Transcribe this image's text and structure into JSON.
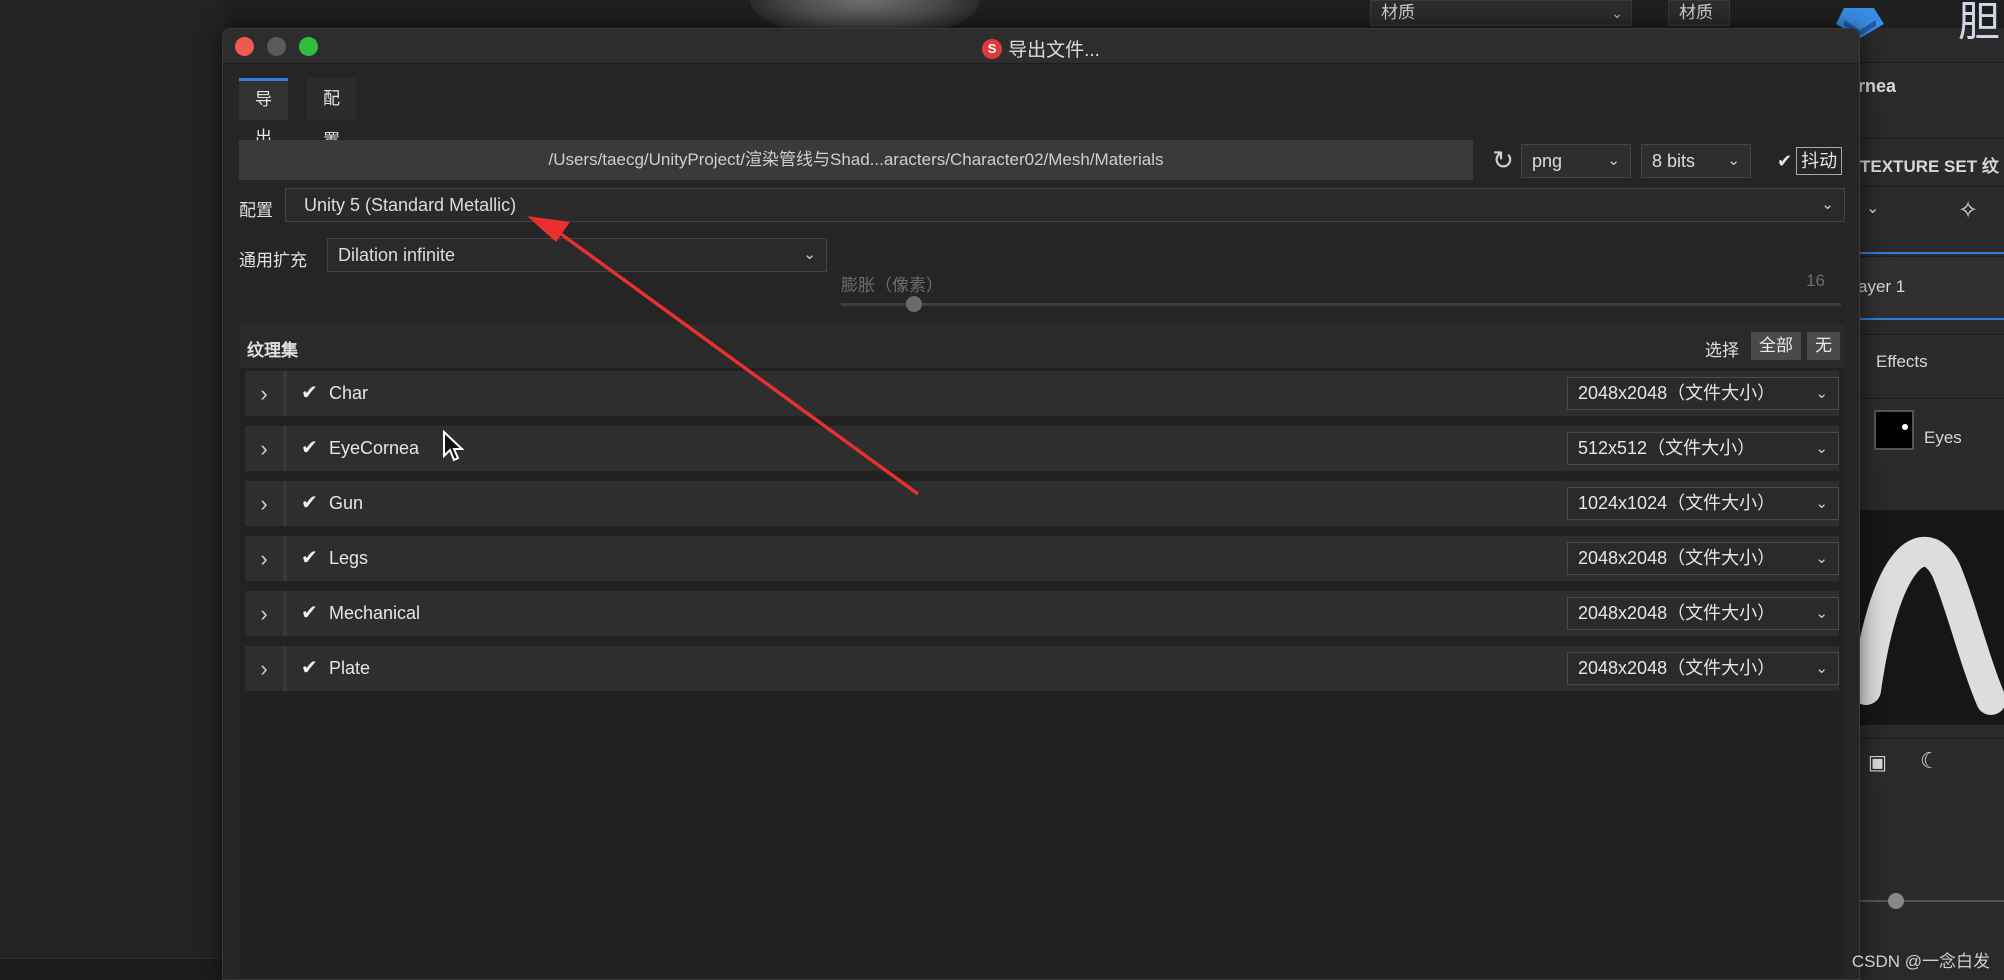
{
  "background": {
    "top_selects": [
      {
        "label": "材质"
      },
      {
        "label": "材质"
      }
    ],
    "right_panel": {
      "item_name_fragment": "rnea",
      "texture_set_label": "TEXTURE SET 纹",
      "layer_label": "ayer 1",
      "effects_label": "Effects",
      "eyes_label": "Eyes",
      "logo_text": "胆"
    }
  },
  "dialog": {
    "title": "导出文件...",
    "tabs": [
      {
        "label": "导出",
        "active": true
      },
      {
        "label": "配置",
        "active": false
      }
    ],
    "output_path": "/Users/taecg/UnityProject/渲染管线与Shad...aracters/Character02/Mesh/Materials",
    "file_format": "png",
    "bit_depth": "8 bits",
    "dithering_label": "抖动",
    "dithering_checked": true,
    "config_label": "配置",
    "config_value": "Unity 5 (Standard Metallic)",
    "padding_label": "通用扩充",
    "padding_value": "Dilation infinite",
    "dilation_label": "膨胀（像素）",
    "dilation_value": "16",
    "texture_sets": {
      "title": "纹理集",
      "select_label": "选择",
      "select_all": "全部",
      "select_none": "无",
      "items": [
        {
          "name": "Char",
          "size": "2048x2048（文件大小）",
          "checked": true
        },
        {
          "name": "EyeCornea",
          "size": "512x512（文件大小）",
          "checked": true
        },
        {
          "name": "Gun",
          "size": "1024x1024（文件大小）",
          "checked": true
        },
        {
          "name": "Legs",
          "size": "2048x2048（文件大小）",
          "checked": true
        },
        {
          "name": "Mechanical",
          "size": "2048x2048（文件大小）",
          "checked": true
        },
        {
          "name": "Plate",
          "size": "2048x2048（文件大小）",
          "checked": true
        }
      ]
    }
  },
  "icons": {
    "close": "close-icon",
    "minimize": "minimize-icon",
    "maximize": "maximize-icon",
    "refresh": "refresh-icon",
    "chevron": "chevron-down-icon",
    "expand": "chevron-right-icon",
    "check": "check-icon"
  },
  "colors": {
    "accent": "#2f7fd8",
    "annotation_arrow": "#e8302f",
    "close": "#f05a52",
    "maximize": "#2fbf3f"
  },
  "watermark": "CSDN @一念白发"
}
